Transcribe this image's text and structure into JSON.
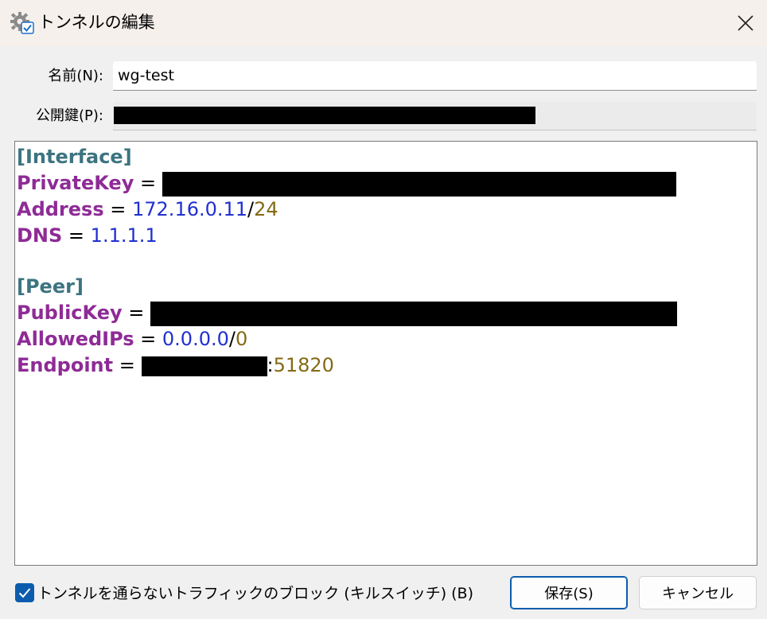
{
  "window": {
    "title": "トンネルの編集",
    "icon": "gear-settings-icon",
    "close_icon": "close-icon"
  },
  "form": {
    "name_label": "名前(N):",
    "name_value": "wg-test",
    "pubkey_label": "公開鍵(P):"
  },
  "config": {
    "interface_header": "[Interface]",
    "private_key_name": "PrivateKey",
    "address_name": "Address",
    "address_ip": "172.16.0.11",
    "address_cidr": "24",
    "dns_name": "DNS",
    "dns_value": "1.1.1.1",
    "peer_header": "[Peer]",
    "public_key_name": "PublicKey",
    "allowed_ips_name": "AllowedIPs",
    "allowed_ips_ip": "0.0.0.0",
    "allowed_ips_cidr": "0",
    "endpoint_name": "Endpoint",
    "endpoint_port": "51820",
    "equals": " = ",
    "slash": "/",
    "colon": ":"
  },
  "footer": {
    "killswitch_label": "トンネルを通らないトラフィックのブロック (キルスイッチ) (B)",
    "killswitch_checked": true,
    "save_label": "保存(S)",
    "cancel_label": "キャンセル"
  },
  "colors": {
    "section": "#3c7480",
    "key": "#8e2b96",
    "ip": "#2030d0",
    "cidr": "#846a16",
    "accent": "#0b5cad"
  }
}
